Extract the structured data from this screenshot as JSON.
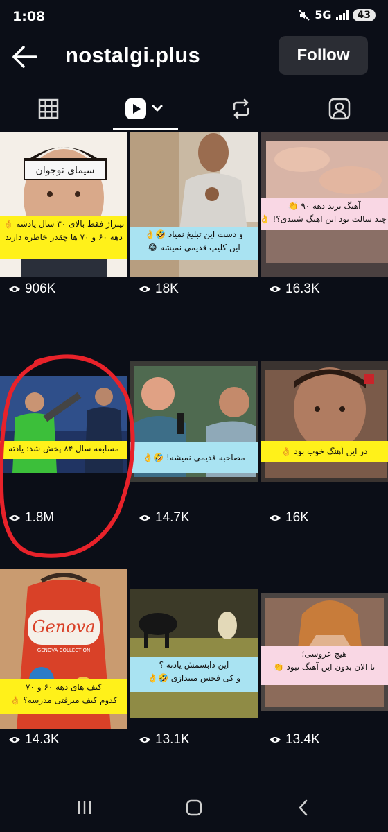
{
  "status": {
    "time": "1:08",
    "network": "5G",
    "battery": "43"
  },
  "header": {
    "title": "nostalgi.plus",
    "follow_label": "Follow"
  },
  "tabs": [
    {
      "icon": "grid-icon"
    },
    {
      "icon": "reels-icon",
      "active": true
    },
    {
      "icon": "repost-icon"
    },
    {
      "icon": "tagged-icon"
    }
  ],
  "posts": [
    {
      "caption": [
        "تیتراژ فقط بالای ۳۰ سال یادشه 👌",
        "دهه ۶۰ و ۷۰ ها چقدر خاطره دارید"
      ],
      "caption_color": "yellow",
      "views": "906K"
    },
    {
      "caption": [
        "و دست این تبلیغ نمیاد 🤣👌",
        "این کلیپ قدیمی نمیشه 😂"
      ],
      "caption_color": "blue",
      "views": "18K"
    },
    {
      "caption": [
        "آهنگ ترند دهه ۹۰ 👏",
        "چند سالت بود این اهنگ شنیدی؟! 👌"
      ],
      "caption_color": "pink",
      "views": "16.3K"
    },
    {
      "caption": [
        "مسابقه سال ۸۴ پخش شد؛ یادته"
      ],
      "caption_color": "yellow",
      "views": "1.8M"
    },
    {
      "caption": [
        "مصاحبه قدیمی نمیشه! 🤣👌"
      ],
      "caption_color": "blue",
      "views": "14.7K"
    },
    {
      "caption": [
        "در این آهنگ خوب بود 👌"
      ],
      "caption_color": "yellow",
      "views": "16K"
    },
    {
      "caption": [
        "کیف های دهه ۶۰ و ۷۰",
        "کدوم کیف میرفتی مدرسه؟ 👌"
      ],
      "caption_color": "yellow",
      "views": "14.3K"
    },
    {
      "caption": [
        "این دابسمش یادته ؟",
        "و کی فحش میندازی 🤣👌"
      ],
      "caption_color": "blue",
      "views": "13.1K"
    },
    {
      "caption": [
        "هیچ عروسی؛",
        "تا الان بدون این آهنگ نبود 👏"
      ],
      "caption_color": "pink",
      "views": "13.4K"
    }
  ],
  "thumb_text": {
    "headband": "سیمای نوجوان",
    "bag_brand": "Genova",
    "bag_sub": "GENOVA COLLECTION"
  },
  "colors": {
    "background": "#0b0e17",
    "follow_bg": "#2b2d34",
    "annotation": "#e8222a",
    "caption_yellow": "#fff11a",
    "caption_blue": "#a9e3f2",
    "caption_pink": "#f9d7e4"
  },
  "nav": [
    {
      "icon": "recent-apps-icon"
    },
    {
      "icon": "home-icon"
    },
    {
      "icon": "back-icon"
    }
  ]
}
